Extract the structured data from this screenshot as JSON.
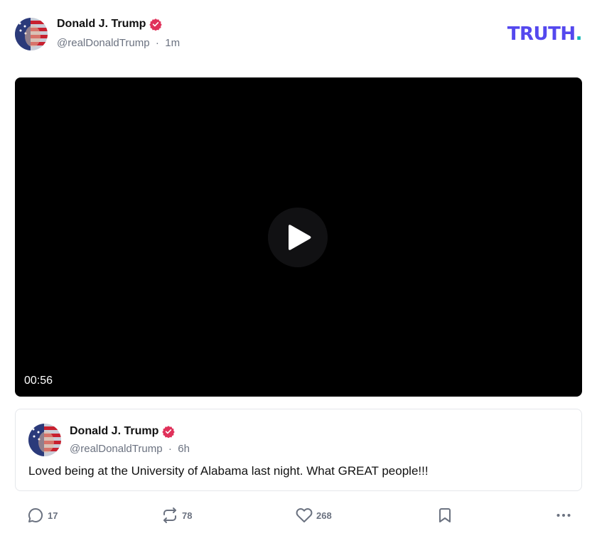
{
  "post": {
    "author_name": "Donald J. Trump",
    "author_handle": "@realDonaldTrump",
    "separator": "·",
    "time": "1m"
  },
  "brand": {
    "logo_text": "TRUTH",
    "logo_dot": "."
  },
  "video": {
    "duration": "00:56",
    "play_icon": "play-icon"
  },
  "quoted_post": {
    "author_name": "Donald J. Trump",
    "author_handle": "@realDonaldTrump",
    "separator": "·",
    "time": "6h",
    "text": "Loved being at the University of Alabama last night. What GREAT people!!!"
  },
  "actions": {
    "reply_count": "17",
    "retruth_count": "78",
    "like_count": "268"
  },
  "colors": {
    "brand_purple": "#5448ee",
    "brand_teal": "#0fb5b5",
    "verified_red": "#e0315a",
    "muted_text": "#6b7280"
  }
}
